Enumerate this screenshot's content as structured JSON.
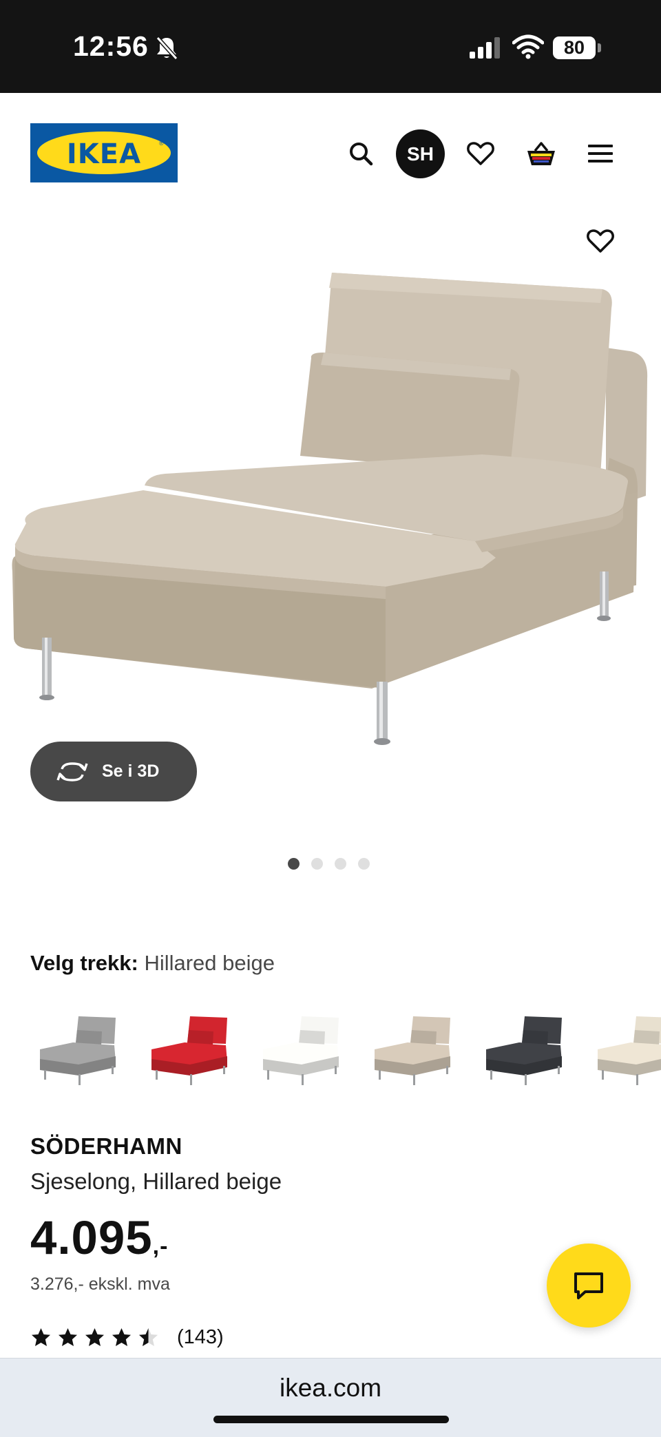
{
  "status_bar": {
    "time": "12:56",
    "battery": "80",
    "icons": [
      "bell-muted-icon",
      "signal-icon",
      "wifi-icon",
      "battery-icon"
    ]
  },
  "header": {
    "logo_text": "IKEA",
    "logo_colors": {
      "blue": "#0a58a3",
      "yellow": "#ffda1a"
    },
    "avatar_initials": "SH",
    "icons": [
      "search-icon",
      "heart-icon",
      "basket-icon",
      "menu-icon"
    ]
  },
  "product_image": {
    "alt": "Chaise longue in beige fabric",
    "view_3d_label": "Se i 3D",
    "dots": {
      "count": 4,
      "active": 1
    }
  },
  "variant": {
    "label": "Velg trekk:",
    "value": "Hillared beige",
    "swatches": [
      {
        "name": "grey",
        "color": "#9a9a9a"
      },
      {
        "name": "red",
        "color": "#c8232c"
      },
      {
        "name": "white",
        "color": "#ebebe8"
      },
      {
        "name": "beige",
        "color": "#c9bdad"
      },
      {
        "name": "black",
        "color": "#3b3d42"
      },
      {
        "name": "light-beige",
        "color": "#ddd5c5"
      }
    ]
  },
  "product": {
    "name": "SÖDERHAMN",
    "description": "Sjeselong, Hillared beige",
    "price": "4.095",
    "price_suffix": ",-",
    "price_ex_vat": "3.276,- ekskl. mva",
    "rating": 4.5,
    "rating_count": "(143)"
  },
  "browser": {
    "url": "ikea.com"
  }
}
